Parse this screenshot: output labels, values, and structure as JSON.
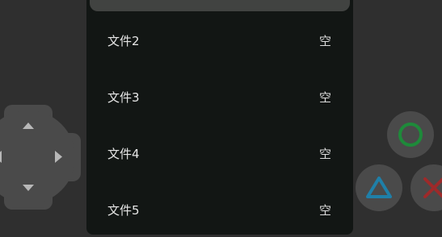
{
  "slots": [
    {
      "label": "文件2",
      "status": "空"
    },
    {
      "label": "文件3",
      "status": "空"
    },
    {
      "label": "文件4",
      "status": "空"
    },
    {
      "label": "文件5",
      "status": "空"
    }
  ],
  "controls": {
    "dpad": "dpad-icon",
    "circle_button": "circle-icon",
    "triangle_button": "triangle-icon",
    "cross_button": "cross-icon"
  },
  "colors": {
    "background": "#2f2f2f",
    "dialog": "#121614",
    "circle": "#1e8a3a",
    "triangle": "#1f7fa8",
    "cross": "#9e2a2a"
  }
}
